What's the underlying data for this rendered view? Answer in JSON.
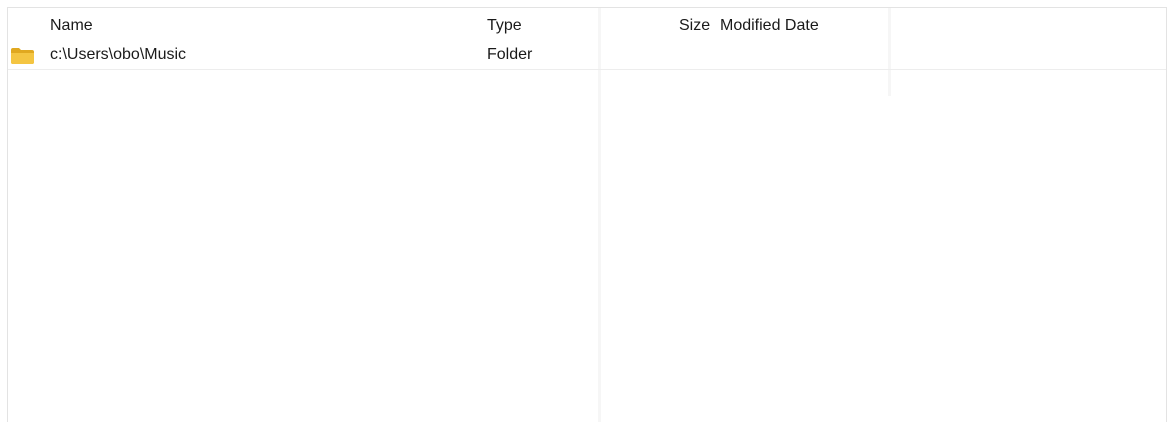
{
  "columns": {
    "name": "Name",
    "type": "Type",
    "size": "Size",
    "modified": "Modified Date"
  },
  "rows": [
    {
      "icon": "folder-icon",
      "name": "c:\\Users\\obo\\Music",
      "type": "Folder",
      "size": "",
      "modified": ""
    }
  ],
  "colors": {
    "folder": "#f4c542",
    "folder_dark": "#e0a820"
  }
}
